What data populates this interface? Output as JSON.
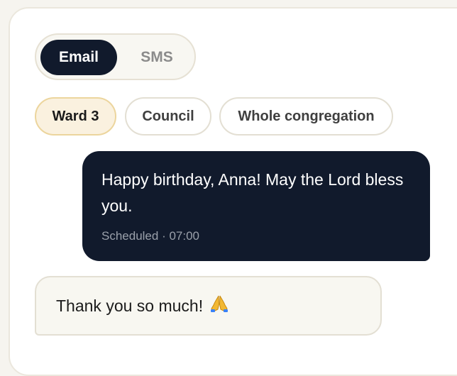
{
  "channel_toggle": {
    "options": [
      "Email",
      "SMS"
    ],
    "selected": "Email"
  },
  "audience_chips": [
    {
      "label": "Ward 3",
      "selected": true
    },
    {
      "label": "Council",
      "selected": false
    },
    {
      "label": "Whole congregation",
      "selected": false
    }
  ],
  "messages": {
    "outgoing": {
      "text": "Happy birthday, Anna! May the Lord bless you.",
      "status": "Scheduled · 07:00"
    },
    "incoming": {
      "text": "Thank you so much!",
      "icon": "praying-hands-icon"
    }
  },
  "colors": {
    "primary_dark": "#111a2c",
    "selected_chip_bg": "#faf1df",
    "selected_chip_border": "#ecd59d"
  }
}
